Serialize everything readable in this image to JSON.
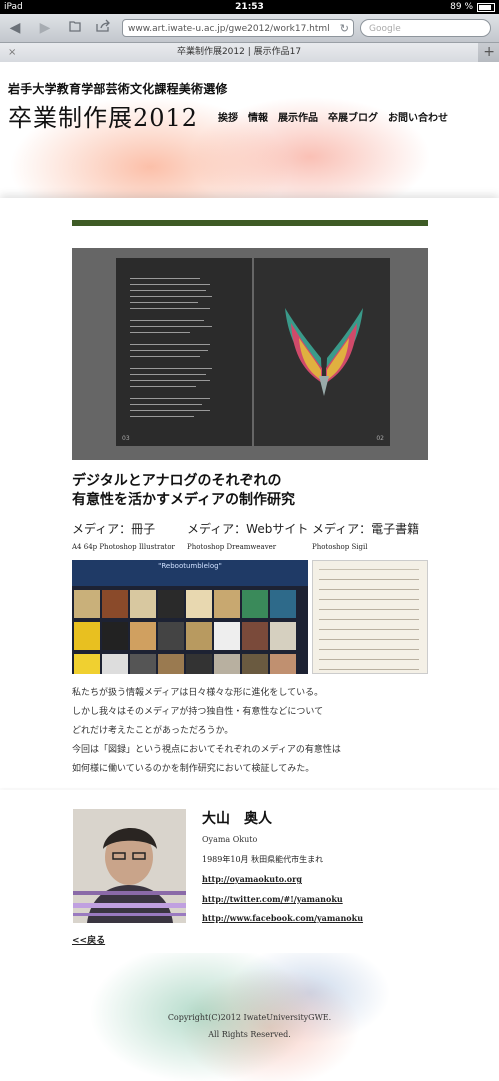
{
  "statusbar": {
    "device": "iPad",
    "time": "21:53",
    "battery": "89 %"
  },
  "browser": {
    "url": "www.art.iwate-u.ac.jp/gwe2012/work17.html",
    "search_placeholder": "Google",
    "tab_title": "卒業制作展2012 | 展示作品17",
    "tab_close": "×",
    "tab_add": "+"
  },
  "header": {
    "university": "岩手大学教育学部芸術文化課程美術選修",
    "title": "卒業制作展2012",
    "nav": [
      "挨拶",
      "情報",
      "展示作品",
      "卒展ブログ",
      "お問い合わせ"
    ]
  },
  "work": {
    "book_pages": [
      "03",
      "02"
    ],
    "title_line1": "デジタルとアナログのそれぞれの",
    "title_line2": "有意性を活かすメディアの制作研究",
    "media": [
      "メディア：冊子",
      "メディア：Webサイト",
      "メディア：電子書籍"
    ],
    "tools": [
      "A4 64p Photoshop Illustrator",
      "Photoshop Dreamweaver",
      "Photoshop Sigil"
    ],
    "web_title": "\"Rebootumblelog\"",
    "description": [
      "私たちが扱う情報メディアは日々様々な形に進化をしている。",
      "しかし我々はそのメディアが持つ独自性・有意性などについて",
      "どれだけ考えたことがあっただろうか。",
      "今回は「図録」という視点においてそれぞれのメディアの有意性は",
      "如何様に働いているのかを制作研究において検証してみた。"
    ]
  },
  "profile": {
    "name": "大山　奥人",
    "romaji": "Oyama Okuto",
    "born": "1989年10月 秋田県能代市生まれ",
    "links": [
      "http://oyamaokuto.org",
      "http://twitter.com/#!/yamanoku",
      "http://www.facebook.com/yamanoku"
    ],
    "back": "<<戻る"
  },
  "footer": {
    "copyright": "Copyright(C)2012 IwateUniversityGWE.",
    "rights": "All Rights Reserved."
  },
  "colors": {
    "accent_bar": "#3e5b25"
  }
}
